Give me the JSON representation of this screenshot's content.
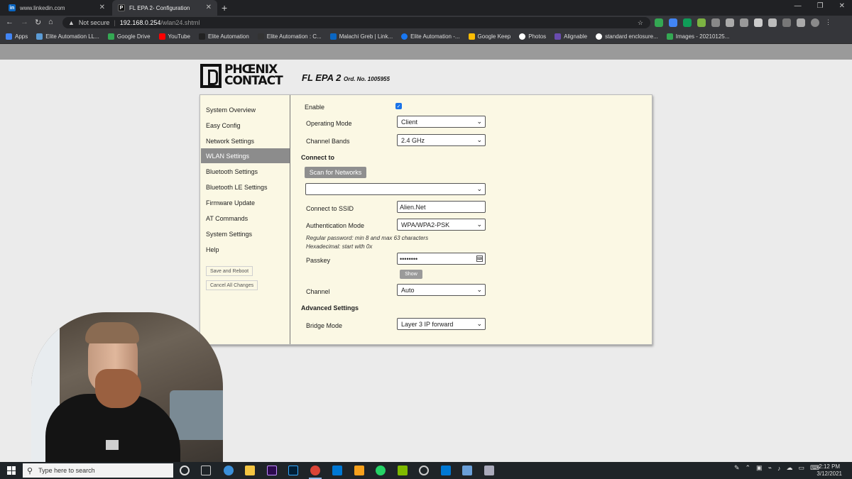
{
  "browser": {
    "tabs": [
      {
        "title": "www.linkedin.com"
      },
      {
        "title": "FL EPA 2- Configuration"
      }
    ],
    "security_label": "Not secure",
    "url_host": "192.168.0.254",
    "url_path": "/wlan24.shtml",
    "bookmarks": [
      "Apps",
      "Elite Automation LL...",
      "Google Drive",
      "YouTube",
      "Elite Automation",
      "Elite Automation : C...",
      "Malachi Greb | Link...",
      "Elite Automation -...",
      "Google Keep",
      "Photos",
      "Alignable",
      "standard enclosure...",
      "Images - 20210125..."
    ]
  },
  "brand": {
    "line1": "PHŒNIX",
    "line2": "CONTACT",
    "product": "FL EPA 2",
    "order": "Ord. No. 1005955"
  },
  "nav": {
    "items": [
      "System Overview",
      "Easy Config",
      "Network Settings",
      "WLAN Settings",
      "Bluetooth Settings",
      "Bluetooth LE Settings",
      "Firmware Update",
      "AT Commands",
      "System Settings",
      "Help"
    ],
    "active_index": 3,
    "save_reboot": "Save and Reboot",
    "cancel_changes": "Cancel All Changes"
  },
  "form": {
    "enable_label": "Enable",
    "enable_checked": true,
    "operating_mode_label": "Operating Mode",
    "operating_mode_value": "Client",
    "channel_bands_label": "Channel Bands",
    "channel_bands_value": "2.4 GHz",
    "connect_to_heading": "Connect to",
    "scan_button": "Scan for Networks",
    "network_select_value": "",
    "ssid_label": "Connect to SSID",
    "ssid_value": "Alien.Net",
    "auth_label": "Authentication Mode",
    "auth_value": "WPA/WPA2-PSK",
    "hint_line1": "Regular password: min 8 and max 63 characters",
    "hint_line2": "Hexadecimal: start with 0x",
    "passkey_label": "Passkey",
    "passkey_value": "••••••••",
    "show_button": "Show",
    "channel_label": "Channel",
    "channel_value": "Auto",
    "advanced_heading": "Advanced Settings",
    "bridge_label": "Bridge Mode",
    "bridge_value": "Layer 3 IP forward"
  },
  "taskbar": {
    "search_placeholder": "Type here to search",
    "time": "2:12 PM",
    "date": "3/12/2021"
  },
  "colors": {
    "panel_bg": "#fbf8e4",
    "nav_active": "#8c8c8c",
    "checkbox": "#1a73e8"
  }
}
